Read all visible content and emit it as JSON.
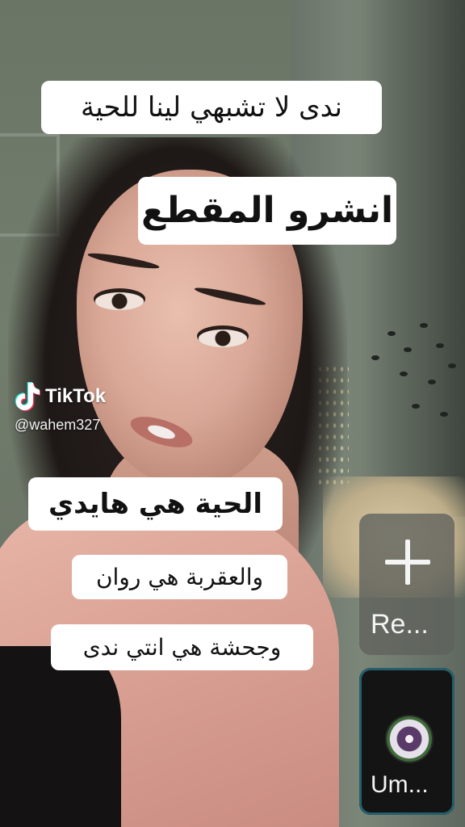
{
  "captions": {
    "line1": "ندى لا تشبهي لينا للحية",
    "line2": "انشرو المقطع",
    "line3": "الحية هي هايدي",
    "line4": "والعقربة هي روان",
    "line5": "وجحشة هي انتي ندى"
  },
  "watermark": {
    "brand": "TikTok",
    "username": "@wahem327",
    "icon": "tiktok-note-icon"
  },
  "side_tiles": {
    "add_tile": {
      "icon": "plus-icon",
      "label": "Re..."
    },
    "audio_tile": {
      "icon": "pansy-flower-disc-icon",
      "label": "Um..."
    }
  },
  "colors": {
    "caption_bg": "#ffffff",
    "caption_text": "#111111",
    "audio_tile_border": "#245f6c"
  }
}
